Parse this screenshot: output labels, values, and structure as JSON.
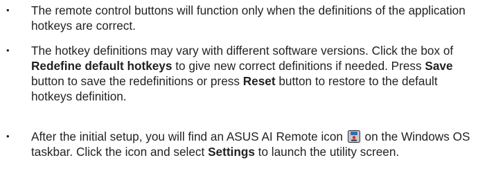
{
  "notes": [
    {
      "bullet": "•",
      "text": "The remote control buttons will function only when the definitions of the application hotkeys are correct."
    },
    {
      "bullet": "•",
      "text_1": "The hotkey definitions may vary with different software versions. Click the box of ",
      "bold_1": "Redefine default hotkeys",
      "text_2": " to give new correct definitions if needed. Press ",
      "bold_2": "Save",
      "text_3": " button to save the redefinitions or press ",
      "bold_3": "Reset",
      "text_4": " button to restore to the default hotkeys definition."
    },
    {
      "bullet": "•",
      "text_1": "After the initial setup, you will find an ASUS AI Remote icon ",
      "icon": "asus-ai-remote-icon",
      "text_2": " on the Windows OS taskbar. Click the icon and select ",
      "bold_1": "Settings",
      "text_3": " to launch the utility screen."
    }
  ],
  "colors": {
    "text": "#231f20",
    "icon_frame": "#2b2b2b",
    "icon_body": "#c8c8c8",
    "icon_accent": "#d8262f",
    "icon_screen": "#2f6db5"
  }
}
